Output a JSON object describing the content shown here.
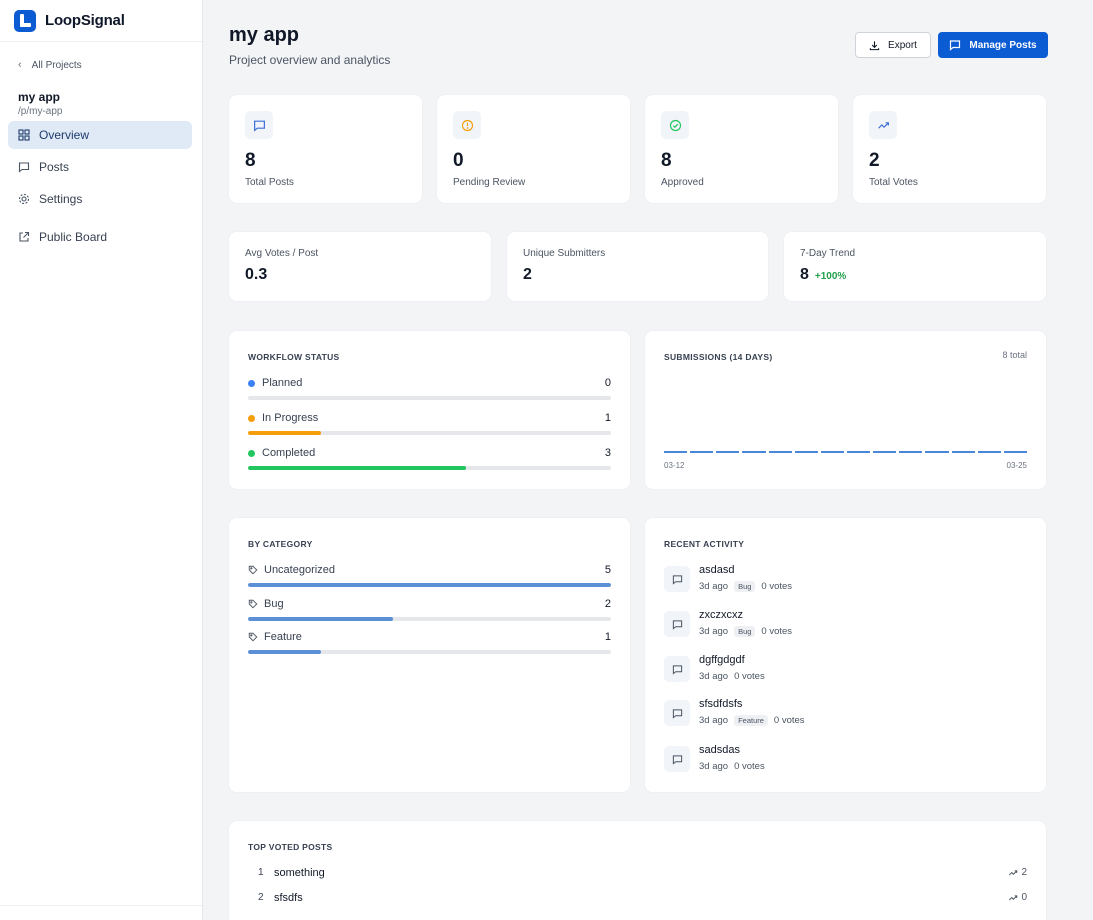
{
  "app": {
    "brand": "LoopSignal"
  },
  "sidebar": {
    "back_label": "All Projects",
    "project_name": "my app",
    "project_slug": "/p/my-app",
    "items": [
      {
        "label": "Overview",
        "icon": "grid-icon",
        "active": true
      },
      {
        "label": "Posts",
        "icon": "message-icon",
        "active": false
      },
      {
        "label": "Settings",
        "icon": "gear-icon",
        "active": false
      },
      {
        "label": "Public Board",
        "icon": "external-link-icon",
        "active": false
      }
    ]
  },
  "header": {
    "title": "my app",
    "subtitle": "Project overview and analytics",
    "export_label": "Export",
    "manage_label": "Manage Posts"
  },
  "stats": [
    {
      "value": "8",
      "label": "Total Posts",
      "icon": "message-icon",
      "color": "#3b6fd6"
    },
    {
      "value": "0",
      "label": "Pending Review",
      "icon": "alert-circle-icon",
      "color": "#f59e0b"
    },
    {
      "value": "8",
      "label": "Approved",
      "icon": "check-circle-icon",
      "color": "#22c55e"
    },
    {
      "value": "2",
      "label": "Total Votes",
      "icon": "trending-up-icon",
      "color": "#3b6fd6"
    }
  ],
  "metrics": [
    {
      "label": "Avg Votes / Post",
      "value": "0.3",
      "delta": ""
    },
    {
      "label": "Unique Submitters",
      "value": "2",
      "delta": ""
    },
    {
      "label": "7-Day Trend",
      "value": "8",
      "delta": "+100%"
    }
  ],
  "workflow": {
    "title": "WORKFLOW STATUS",
    "max": 5,
    "items": [
      {
        "label": "Planned",
        "count": 0,
        "color": "#3b82f6"
      },
      {
        "label": "In Progress",
        "count": 1,
        "color": "#f59e0b"
      },
      {
        "label": "Completed",
        "count": 3,
        "color": "#22c55e"
      }
    ]
  },
  "submissions": {
    "title": "SUBMISSIONS (14 DAYS)",
    "total_label": "8 total",
    "start_label": "03-12",
    "end_label": "03-25",
    "days": 14
  },
  "categories": {
    "title": "BY CATEGORY",
    "max": 5,
    "color": "#5b8fd6",
    "items": [
      {
        "label": "Uncategorized",
        "count": 5
      },
      {
        "label": "Bug",
        "count": 2
      },
      {
        "label": "Feature",
        "count": 1
      }
    ]
  },
  "activity": {
    "title": "RECENT ACTIVITY",
    "items": [
      {
        "title": "asdasd",
        "time": "3d ago",
        "tag": "Bug",
        "votes": "0 votes"
      },
      {
        "title": "zxczxcxz",
        "time": "3d ago",
        "tag": "Bug",
        "votes": "0 votes"
      },
      {
        "title": "dgffgdgdf",
        "time": "3d ago",
        "tag": "",
        "votes": "0 votes"
      },
      {
        "title": "sfsdfdsfs",
        "time": "3d ago",
        "tag": "Feature",
        "votes": "0 votes"
      },
      {
        "title": "sadsdas",
        "time": "3d ago",
        "tag": "",
        "votes": "0 votes"
      }
    ]
  },
  "top_voted": {
    "title": "TOP VOTED POSTS",
    "items": [
      {
        "rank": "1",
        "title": "something",
        "votes": "2"
      },
      {
        "rank": "2",
        "title": "sfsdfs",
        "votes": "0"
      }
    ]
  }
}
